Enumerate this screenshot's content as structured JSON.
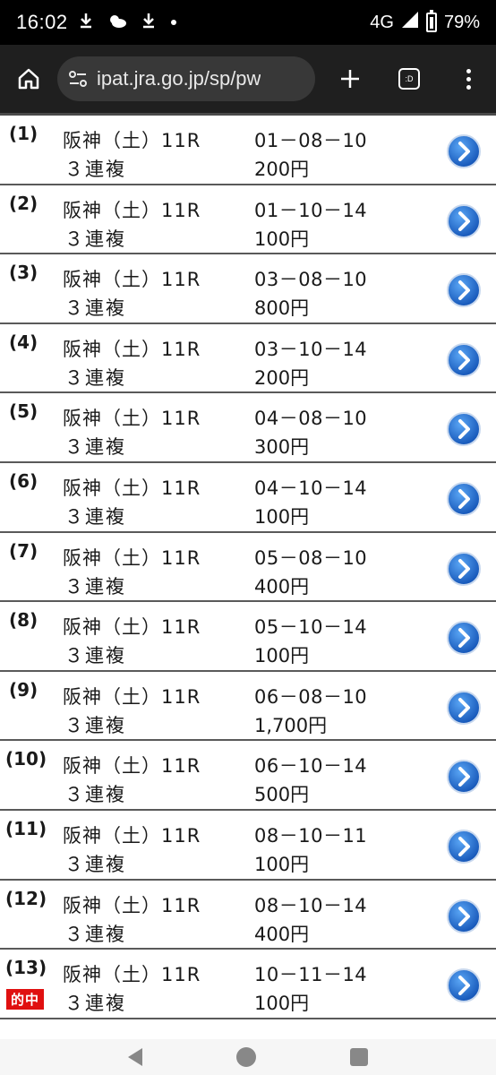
{
  "status_bar": {
    "time": "16:02",
    "network": "4G",
    "battery": "79%"
  },
  "browser": {
    "url": "ipat.jra.go.jp/sp/pw",
    "tab_label": ":D"
  },
  "bets": [
    {
      "num": "(1)",
      "race": "阪神（土）11R",
      "type": "３連複",
      "combo": "01－08－10",
      "amount": "200円"
    },
    {
      "num": "(2)",
      "race": "阪神（土）11R",
      "type": "３連複",
      "combo": "01－10－14",
      "amount": "100円"
    },
    {
      "num": "(3)",
      "race": "阪神（土）11R",
      "type": "３連複",
      "combo": "03－08－10",
      "amount": "800円"
    },
    {
      "num": "(4)",
      "race": "阪神（土）11R",
      "type": "３連複",
      "combo": "03－10－14",
      "amount": "200円"
    },
    {
      "num": "(5)",
      "race": "阪神（土）11R",
      "type": "３連複",
      "combo": "04－08－10",
      "amount": "300円"
    },
    {
      "num": "(6)",
      "race": "阪神（土）11R",
      "type": "３連複",
      "combo": "04－10－14",
      "amount": "100円"
    },
    {
      "num": "(7)",
      "race": "阪神（土）11R",
      "type": "３連複",
      "combo": "05－08－10",
      "amount": "400円"
    },
    {
      "num": "(8)",
      "race": "阪神（土）11R",
      "type": "３連複",
      "combo": "05－10－14",
      "amount": "100円"
    },
    {
      "num": "(9)",
      "race": "阪神（土）11R",
      "type": "３連複",
      "combo": "06－08－10",
      "amount": "1,700円"
    },
    {
      "num": "(10)",
      "race": "阪神（土）11R",
      "type": "３連複",
      "combo": "06－10－14",
      "amount": "500円"
    },
    {
      "num": "(11)",
      "race": "阪神（土）11R",
      "type": "３連複",
      "combo": "08－10－11",
      "amount": "100円"
    },
    {
      "num": "(12)",
      "race": "阪神（土）11R",
      "type": "３連複",
      "combo": "08－10－14",
      "amount": "400円"
    },
    {
      "num": "(13)",
      "race": "阪神（土）11R",
      "type": "３連複",
      "combo": "10－11－14",
      "amount": "100円",
      "hit": "的中"
    }
  ],
  "colors": {
    "arrow_blue": "#1f6fd6",
    "hit_red": "#e01010"
  }
}
